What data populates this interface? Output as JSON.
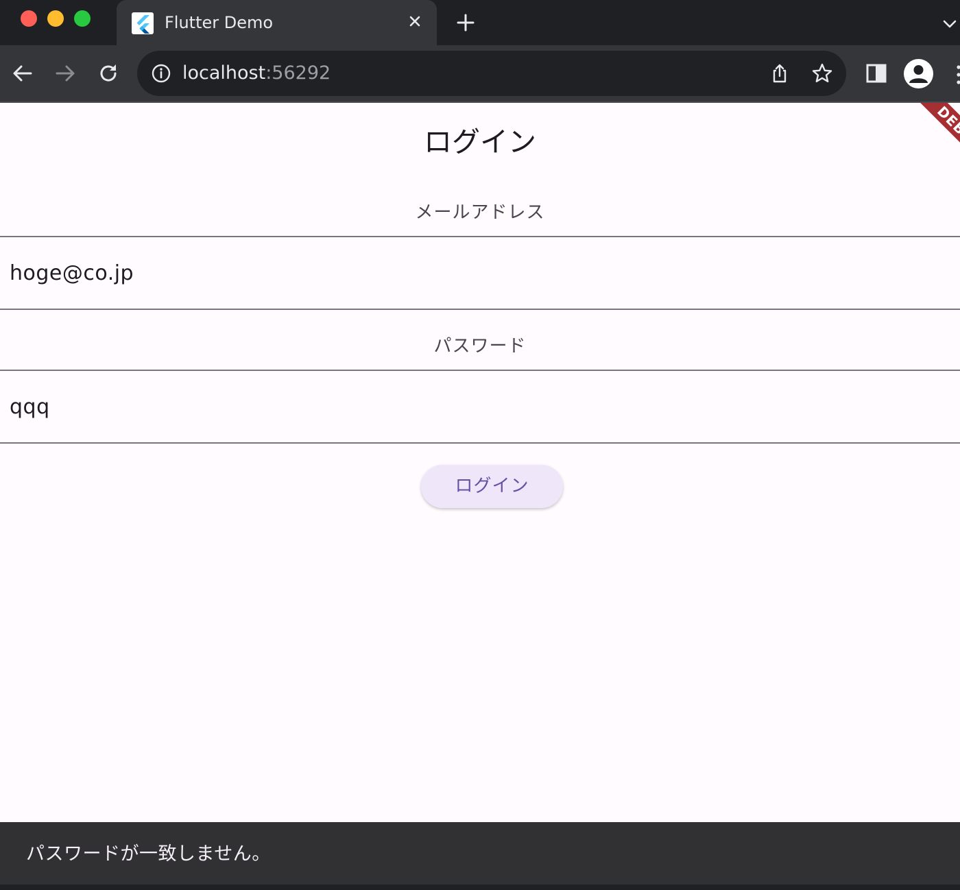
{
  "browser": {
    "tab": {
      "title": "Flutter Demo",
      "favicon": "flutter-logo-icon"
    },
    "url": {
      "host": "localhost",
      "port": ":56292"
    }
  },
  "page": {
    "title": "ログイン",
    "email": {
      "label": "メールアドレス",
      "value": "hoge@co.jp"
    },
    "password": {
      "label": "パスワード",
      "value": "qqq"
    },
    "login_button": "ログイン",
    "debug_banner": "DEBUG"
  },
  "snackbar": {
    "message": "パスワードが一致しません。"
  },
  "colors": {
    "accent": "#6750a4",
    "button_bg": "#efe6fa",
    "page_bg": "#fffbfe",
    "snackbar_bg": "#313033",
    "debug_banner": "#a52f33"
  }
}
